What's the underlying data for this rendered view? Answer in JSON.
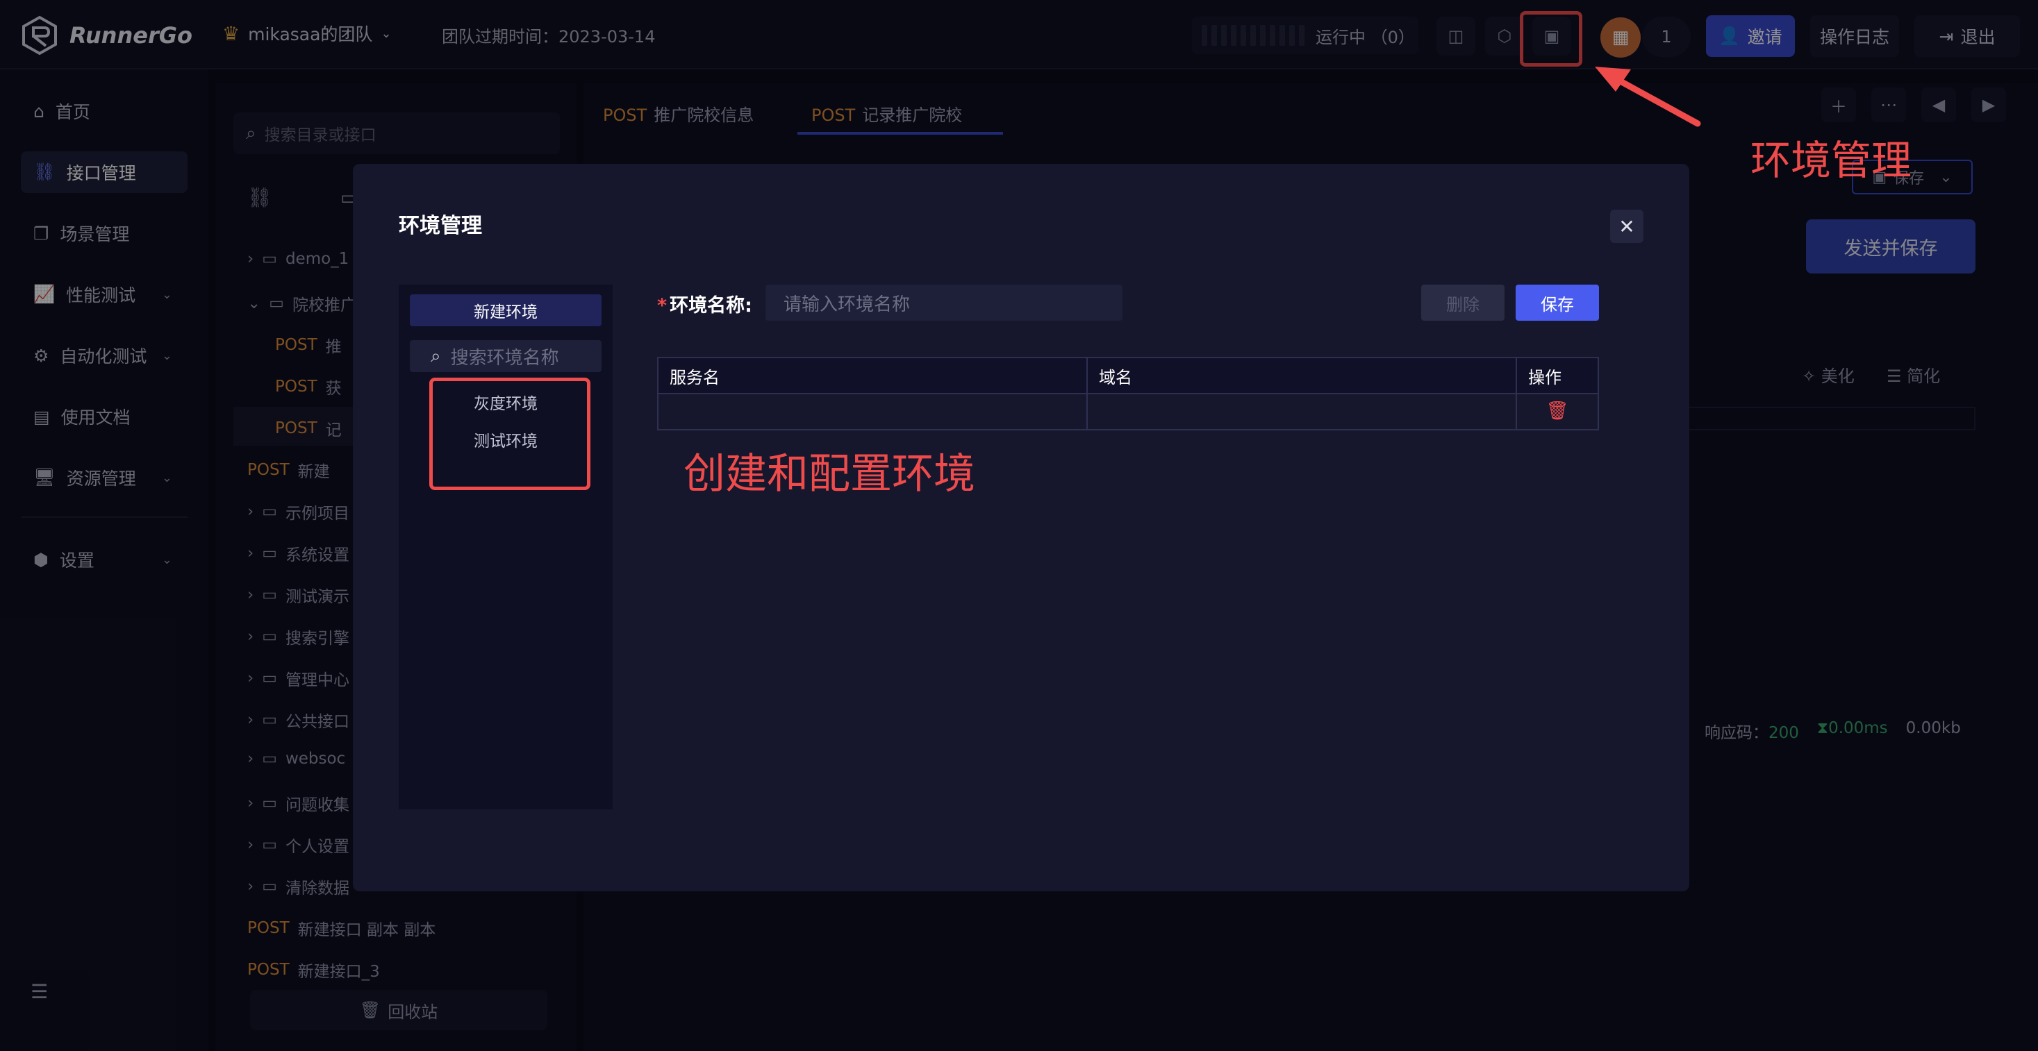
{
  "app": {
    "logo_text": "RunnerGo"
  },
  "header": {
    "team_name": "mikasaa的团队",
    "expiry": "团队过期时间：2023-03-14",
    "running": "运行中 （0）",
    "member_count": "1",
    "invite_label": "邀请",
    "oplog_label": "操作日志",
    "logout_label": "退出"
  },
  "sidebar": {
    "items": [
      {
        "label": "首页"
      },
      {
        "label": "接口管理"
      },
      {
        "label": "场景管理"
      },
      {
        "label": "性能测试"
      },
      {
        "label": "自动化测试"
      },
      {
        "label": "使用文档"
      },
      {
        "label": "资源管理"
      },
      {
        "label": "设置"
      }
    ]
  },
  "tree": {
    "search_placeholder": "搜索目录或接口",
    "rows": [
      {
        "label": "demo_1"
      },
      {
        "label": "院校推广"
      },
      {
        "method": "POST",
        "label": "推"
      },
      {
        "method": "POST",
        "label": "获"
      },
      {
        "method": "POST",
        "label": "记"
      },
      {
        "method": "POST",
        "label": "新建"
      },
      {
        "label": "示例项目"
      },
      {
        "label": "系统设置"
      },
      {
        "label": "测试演示"
      },
      {
        "label": "搜索引擎"
      },
      {
        "label": "管理中心"
      },
      {
        "label": "公共接口"
      },
      {
        "label": "websoc"
      },
      {
        "label": "问题收集"
      },
      {
        "label": "个人设置"
      },
      {
        "label": "清除数据"
      },
      {
        "method": "POST",
        "label": "新建接口 副本 副本"
      },
      {
        "method": "POST",
        "label": "新建接口_3"
      }
    ],
    "recycle_label": "回收站"
  },
  "tabs": [
    {
      "method": "POST",
      "label": "推广院校信息"
    },
    {
      "method": "POST",
      "label": "记录推广院校"
    }
  ],
  "background": {
    "save_label": "保存",
    "send_save_label": "发送并保存",
    "beautify_label": "美化",
    "simplify_label": "简化",
    "status_code_label": "响应码：",
    "status_code": "200",
    "time": "0.00ms",
    "size": "0.00kb"
  },
  "modal": {
    "title": "环境管理",
    "new_env_label": "新建环境",
    "env_search_placeholder": "搜索环境名称",
    "envs": [
      {
        "label": "灰度环境"
      },
      {
        "label": "测试环境"
      }
    ],
    "name_label": "环境名称:",
    "name_placeholder": "请输入环境名称",
    "delete_label": "删除",
    "save_label": "保存",
    "table": {
      "columns": [
        "服务名",
        "域名",
        "操作"
      ]
    }
  },
  "annotations": {
    "env_mgmt": "环境管理",
    "create_config": "创建和配置环境",
    "color": "#ef4b4b"
  },
  "colors": {
    "accent": "#4a5cf0",
    "method": "#d98a3a",
    "success": "#3aa36b"
  }
}
